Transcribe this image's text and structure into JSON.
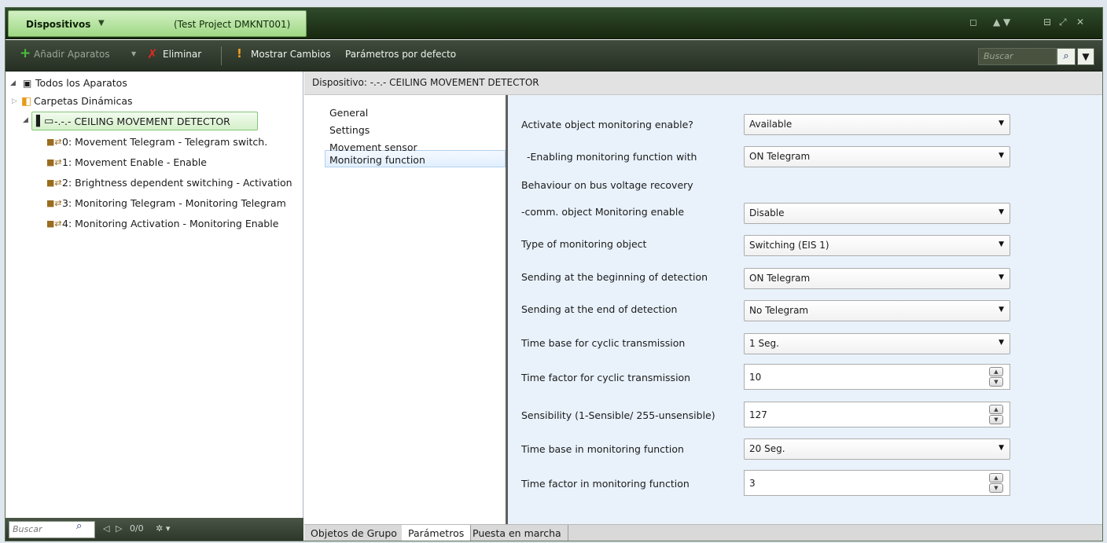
{
  "titlebar": {
    "title": "Dispositivos",
    "dropdown_arrow": "▼",
    "project": "(Test Project DMKNT001)",
    "window_controls": [
      "◻",
      "▲ ▼",
      "⊟",
      "⤢",
      "✕"
    ]
  },
  "toolbar": {
    "add_label": "Añadir Aparatos",
    "add_icon": "plus-icon",
    "delete_label": "Eliminar",
    "delete_icon": "delete-icon",
    "changes_label": "Mostrar Cambios",
    "changes_icon": "exclamation-icon",
    "defaults_label": "Parámetros por defecto",
    "search_placeholder": "Buscar"
  },
  "tree": {
    "root_label": "Todos los Aparatos",
    "dynamic_folders_label": "Carpetas Dinámicas",
    "device_label": "-.-.-  CEILING MOVEMENT DETECTOR",
    "objects": [
      "0: Movement Telegram - Telegram switch.",
      "1: Movement Enable - Enable",
      "2: Brightness dependent switching - Activation",
      "3: Monitoring Telegram - Monitoring Telegram",
      "4: Monitoring Activation - Monitoring Enable"
    ],
    "search_placeholder": "Buscar",
    "counter": "0/0"
  },
  "device_header": "Dispositivo: -.-.-  CEILING MOVEMENT DETECTOR",
  "nav": {
    "items": [
      "General",
      "Settings",
      "Movement sensor",
      "Monitoring function"
    ],
    "selected": "Monitoring function"
  },
  "params": [
    {
      "label": "Activate object monitoring enable?",
      "value": "Available",
      "type": "combo"
    },
    {
      "label": "  -Enabling monitoring function with",
      "value": "ON Telegram",
      "type": "combo"
    },
    {
      "label": "Behaviour on bus voltage recovery",
      "value": "",
      "type": "label"
    },
    {
      "label": "-comm. object  Monitoring enable",
      "value": "Disable",
      "type": "combo"
    },
    {
      "label": "Type of monitoring object",
      "value": "Switching (EIS 1)",
      "type": "combo"
    },
    {
      "label": "Sending at the beginning of detection",
      "value": "ON Telegram",
      "type": "combo"
    },
    {
      "label": "Sending at the end of detection",
      "value": "No Telegram",
      "type": "combo"
    },
    {
      "label": "Time base for cyclic transmission",
      "value": "1 Seg.",
      "type": "combo"
    },
    {
      "label": "Time factor for cyclic transmission",
      "value": "10",
      "type": "spin"
    },
    {
      "label": "Sensibility (1-Sensible/ 255-unsensible)",
      "value": "127",
      "type": "spin"
    },
    {
      "label": "Time base  in monitoring function",
      "value": "20 Seg.",
      "type": "combo"
    },
    {
      "label": "Time factor  in monitoring function",
      "value": "3",
      "type": "spin"
    }
  ],
  "tabs": [
    "Objetos de Grupo",
    "Parámetros",
    "Puesta en marcha"
  ],
  "active_tab": "Parámetros",
  "colors": {
    "titlebar": "#2f4a2b",
    "title_tab": "#b8e6a4",
    "toolbar": "#333d30",
    "params_bg": "#e9f2fb",
    "selected_device": "#d4f0c9"
  }
}
